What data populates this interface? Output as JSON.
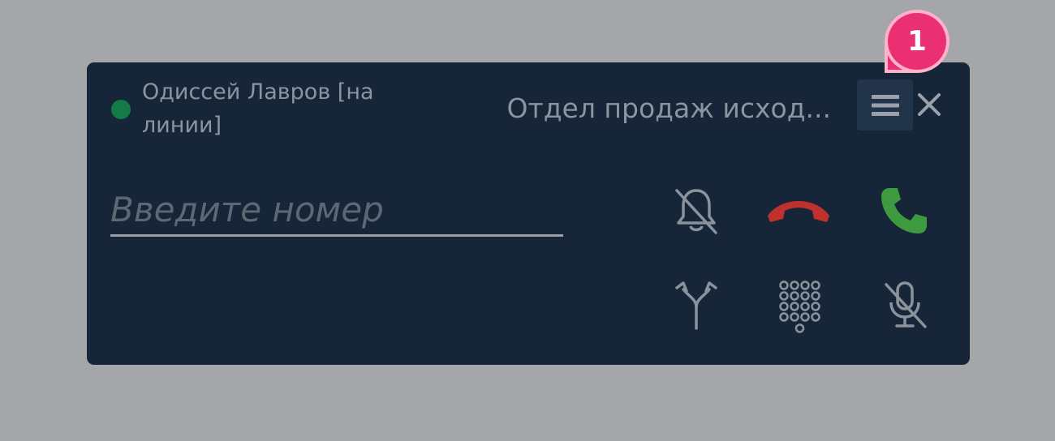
{
  "operator": {
    "name": "Одиссей Лавров [на линии]",
    "status_color": "#137a48"
  },
  "queue": {
    "label": "Отдел продаж исход..."
  },
  "toolbar": {
    "menu_icon": "menu-icon",
    "close_icon": "close-icon"
  },
  "dialer": {
    "input_value": "",
    "input_placeholder": "Введите номер"
  },
  "actions": {
    "mute_notifications_icon": "bell-off-icon",
    "hangup_icon": "phone-hangup-icon",
    "call_icon": "phone-call-icon",
    "transfer_icon": "transfer-split-icon",
    "keypad_icon": "dialpad-icon",
    "mic_off_icon": "mic-off-icon",
    "hangup_color": "#c0302c",
    "call_color": "#3d9a3f"
  },
  "annotation": {
    "step": "1",
    "color": "#eb2f73"
  }
}
